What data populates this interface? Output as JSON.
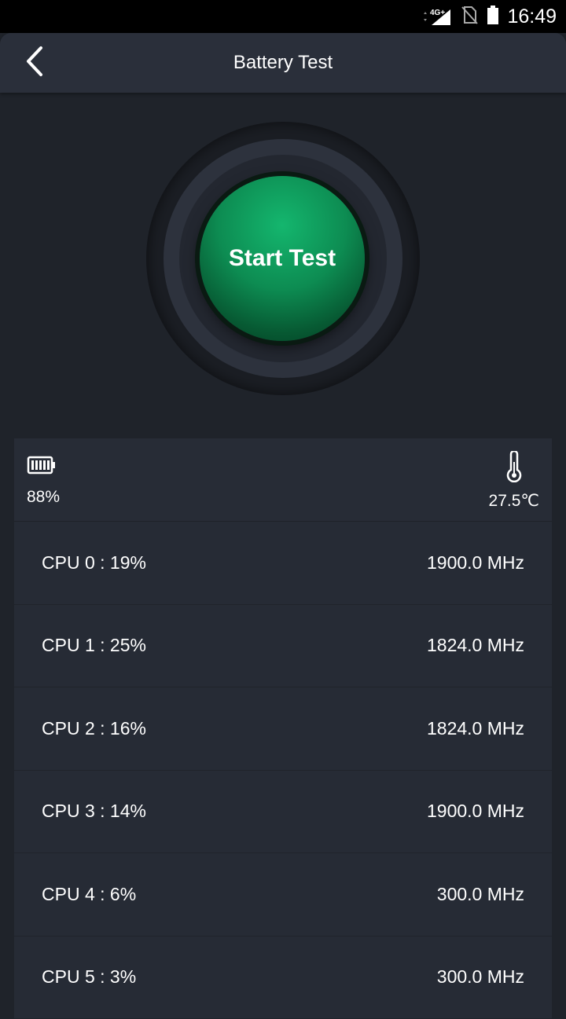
{
  "status_bar": {
    "network": "4G+",
    "time": "16:49"
  },
  "header": {
    "title": "Battery Test"
  },
  "hero": {
    "button_label": "Start Test"
  },
  "summary": {
    "battery_percent": "88%",
    "temperature": "27.5℃"
  },
  "cpus": [
    {
      "label": "CPU  0 : 19%",
      "freq": "1900.0 MHz"
    },
    {
      "label": "CPU  1 : 25%",
      "freq": "1824.0 MHz"
    },
    {
      "label": "CPU  2 : 16%",
      "freq": "1824.0 MHz"
    },
    {
      "label": "CPU  3 : 14%",
      "freq": "1900.0 MHz"
    },
    {
      "label": "CPU  4 : 6%",
      "freq": "300.0 MHz"
    },
    {
      "label": "CPU  5 : 3%",
      "freq": "300.0 MHz"
    }
  ],
  "colors": {
    "background": "#1f232a",
    "app_bar": "#2a2f3a",
    "panel": "#262b35",
    "accent_green": "#0d8c52"
  }
}
